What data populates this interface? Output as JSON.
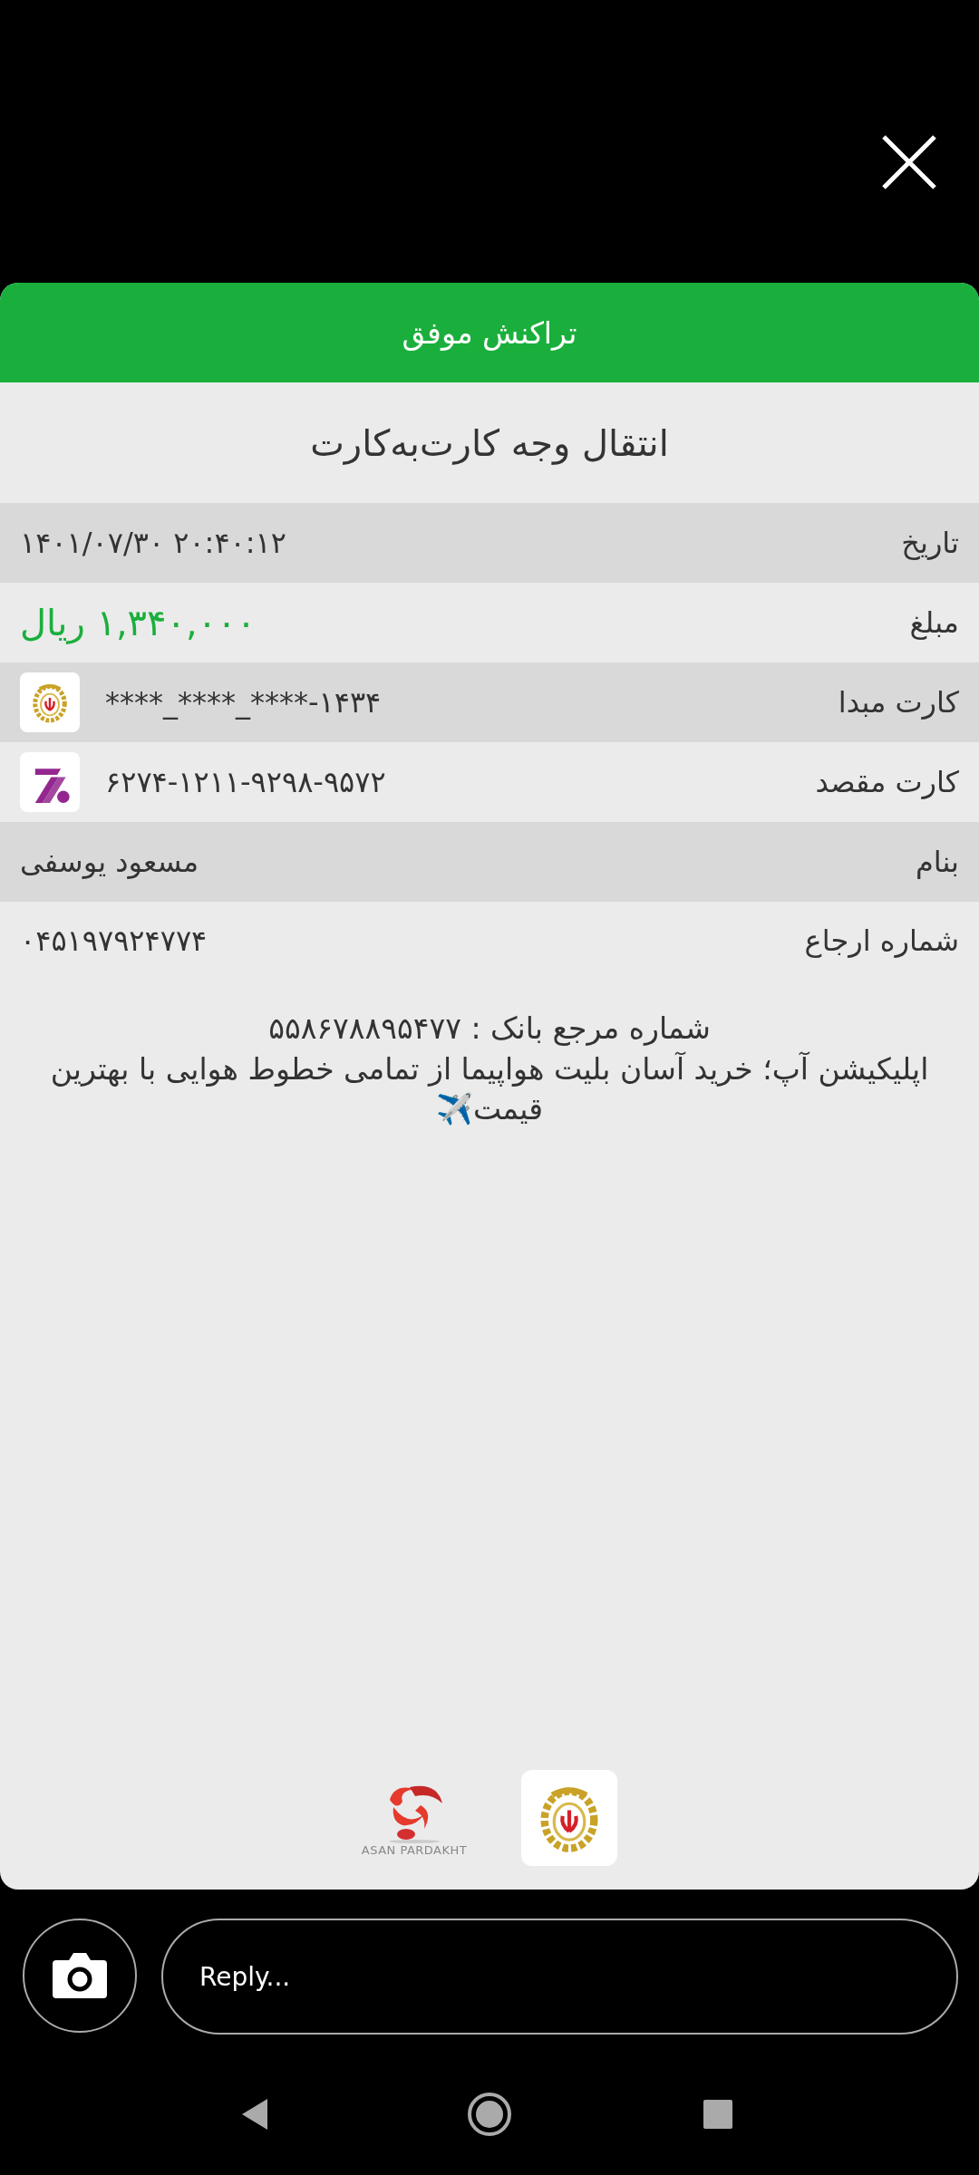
{
  "status_title": "تراکنش موفق",
  "subtitle": "انتقال وجه کارت‌به‌کارت",
  "rows": [
    {
      "kind": "text",
      "label": "تاریخ",
      "value": "۱۴۰۱/۰۷/۳۰ ۲۰:۴۰:۱۲"
    },
    {
      "kind": "amount",
      "label": "مبلغ",
      "value": "۱,۳۴۰,۰۰۰ ریال"
    },
    {
      "kind": "card",
      "label": "کارت مبدا",
      "value": "****_****_****-۱۴۳۴"
    },
    {
      "kind": "card",
      "label": "کارت مقصد",
      "value": "۶۲۷۴-۱۲۱۱-۹۲۹۸-۹۵۷۲"
    },
    {
      "kind": "text",
      "label": "بنام",
      "value": "مسعود یوسفی"
    },
    {
      "kind": "text",
      "label": "شماره ارجاع",
      "value": "۰۴۵۱۹۷۹۲۴۷۷۴"
    }
  ],
  "message": [
    "شماره مرجع بانک : ۵۵۸۶۷۸۸۹۵۴۷۷",
    "اپلیکیشن آپ؛ خرید آسان بلیت هواپیما از تمامی خطوط هوایی با بهترین قیمت✈️"
  ],
  "logo_text": "ASAN PARDAKHT",
  "reply": {
    "placeholder": "Reply..."
  }
}
